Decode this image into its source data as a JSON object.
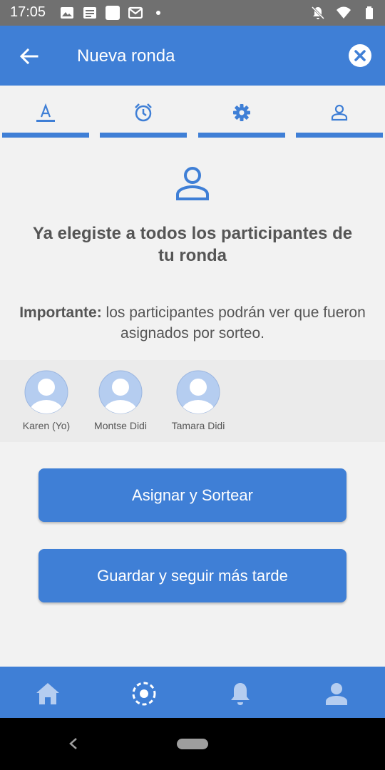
{
  "status_bar": {
    "time": "17:05",
    "left_icons": [
      "image-icon",
      "news-icon",
      "square-icon",
      "gmail-icon",
      "dot-icon"
    ],
    "right_icons": [
      "bell-off-icon",
      "wifi-icon",
      "battery-icon"
    ]
  },
  "app_bar": {
    "title": "Nueva ronda",
    "back_icon": "arrow-left-icon",
    "close_icon": "close-circle-icon"
  },
  "tabs": [
    {
      "icon": "text-format-icon",
      "active": true
    },
    {
      "icon": "alarm-icon",
      "active": false
    },
    {
      "icon": "gear-icon",
      "active": false
    },
    {
      "icon": "person-icon",
      "active": false
    }
  ],
  "main": {
    "headline": "Ya elegiste a todos los participantes de tu ronda",
    "note_strong": "Importante:",
    "note_text": " los participantes podrán ver que fueron asignados por sorteo."
  },
  "participants": [
    {
      "name": "Karen (Yo)"
    },
    {
      "name": "Montse Didi"
    },
    {
      "name": "Tamara Didi"
    }
  ],
  "buttons": {
    "assign": "Asignar y Sortear",
    "save": "Guardar y seguir más tarde"
  },
  "bottom_nav": [
    "home-icon",
    "target-icon",
    "bell-icon",
    "profile-icon"
  ],
  "colors": {
    "primary": "#3f7fd6",
    "background": "#f2f2f2",
    "status_bar": "#707070",
    "avatar": "#b5cdf0"
  }
}
